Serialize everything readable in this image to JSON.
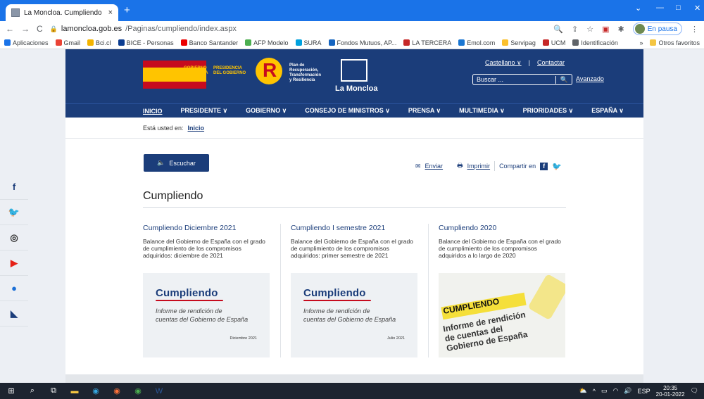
{
  "browser": {
    "tab_title": "La Moncloa. Cumpliendo",
    "tab_close": "×",
    "new_tab": "+",
    "url_host": "lamoncloa.gob.es",
    "url_path": "/Paginas/cumpliendo/index.aspx",
    "profile_status": "En pausa",
    "nav_back": "←",
    "nav_forward": "→",
    "nav_reload": "C",
    "win_min": "—",
    "win_max": "□",
    "win_close": "✕",
    "win_chevron": "⌄"
  },
  "bookmarks": [
    {
      "label": "Aplicaciones",
      "color": "#1a73e8"
    },
    {
      "label": "Gmail",
      "color": "#ea4335"
    },
    {
      "label": "Bci.cl",
      "color": "#f4b400"
    },
    {
      "label": "BICE - Personas",
      "color": "#0b3d91"
    },
    {
      "label": "Banco Santander",
      "color": "#ec0000"
    },
    {
      "label": "AFP Modelo",
      "color": "#4caf50"
    },
    {
      "label": "SURA",
      "color": "#00a1de"
    },
    {
      "label": "Fondos Mutuos, AP...",
      "color": "#1565c0"
    },
    {
      "label": "LA TERCERA",
      "color": "#c62828"
    },
    {
      "label": "Emol.com",
      "color": "#1976d2"
    },
    {
      "label": "Servipag",
      "color": "#fbc02d"
    },
    {
      "label": "UCM",
      "color": "#c62828"
    },
    {
      "label": "Identificación",
      "color": "#5f6368"
    }
  ],
  "bookmarks_other": "Otros favoritos",
  "header": {
    "gob_line1": "GOBIERNO",
    "gob_line2": "DE ESPAÑA",
    "pres_line1": "PRESIDENCIA",
    "pres_line2": "DEL GOBIERNO",
    "prtr_lines": [
      "Plan de",
      "Recuperación,",
      "Transformación",
      "y Resiliencia"
    ],
    "moncloa": "La Moncloa",
    "lang": "Castellano",
    "lang_caret": "∨",
    "sep": "|",
    "contact": "Contactar",
    "search_placeholder": "Buscar ...",
    "search_icon": "🔍",
    "advanced": "Avanzado"
  },
  "nav": [
    {
      "label": "INICIO",
      "active": true
    },
    {
      "label": "PRESIDENTE ∨"
    },
    {
      "label": "GOBIERNO ∨"
    },
    {
      "label": "CONSEJO DE MINISTROS ∨"
    },
    {
      "label": "PRENSA ∨"
    },
    {
      "label": "MULTIMEDIA ∨"
    },
    {
      "label": "PRIORIDADES ∨"
    },
    {
      "label": "ESPAÑA ∨"
    }
  ],
  "breadcrumb": {
    "prefix": "Está usted en:",
    "home": "Inicio"
  },
  "listen": {
    "icon": "🔈",
    "label": "Escuchar"
  },
  "share": {
    "send_icon": "✉",
    "send": "Enviar",
    "print_icon": "🖶",
    "print": "Imprimir",
    "share_label": "Compartir en",
    "fb": "f",
    "tw": "🐦"
  },
  "page_title": "Cumpliendo",
  "cards": [
    {
      "title": "Cumpliendo Diciembre 2021",
      "desc": "Balance del Gobierno de España con el grado de cumplimiento de los compromisos adquiridos: diciembre de 2021",
      "big": "Cumpliendo",
      "sub1": "Informe de rendición de",
      "sub2": "cuentas del Gobierno de España",
      "date": "Diciembre 2021"
    },
    {
      "title": "Cumpliendo I semestre 2021",
      "desc": "Balance del Gobierno de España con el grado de cumplimiento de los compromisos adquiridos: primer semestre de 2021",
      "big": "Cumpliendo",
      "sub1": "Informe de rendición de",
      "sub2": "cuentas del Gobierno de España",
      "date": "Julio 2021"
    },
    {
      "title": "Cumpliendo 2020",
      "desc": "Balance del Gobierno de España con el grado de cumplimiento de los compromisos adquiridos a lo largo de 2020",
      "big": "CUMPLIENDO",
      "sub1": "Informe de rendición",
      "sub2": "de cuentas del",
      "sub3": "Gobierno de España"
    }
  ],
  "social": [
    {
      "name": "facebook-icon",
      "glyph": "f",
      "color": "#1b3d7a"
    },
    {
      "name": "twitter-icon",
      "glyph": "🐦",
      "color": "#1da1f2"
    },
    {
      "name": "instagram-icon",
      "glyph": "◎",
      "color": "#333"
    },
    {
      "name": "youtube-icon",
      "glyph": "▶",
      "color": "#e62117"
    },
    {
      "name": "flickr-icon",
      "glyph": "●",
      "color": "#1b6fd6"
    },
    {
      "name": "rss-icon",
      "glyph": "◣",
      "color": "#1b3d7a"
    }
  ],
  "taskbar": {
    "lang": "ESP",
    "time": "20:35",
    "date": "20-01-2022"
  }
}
